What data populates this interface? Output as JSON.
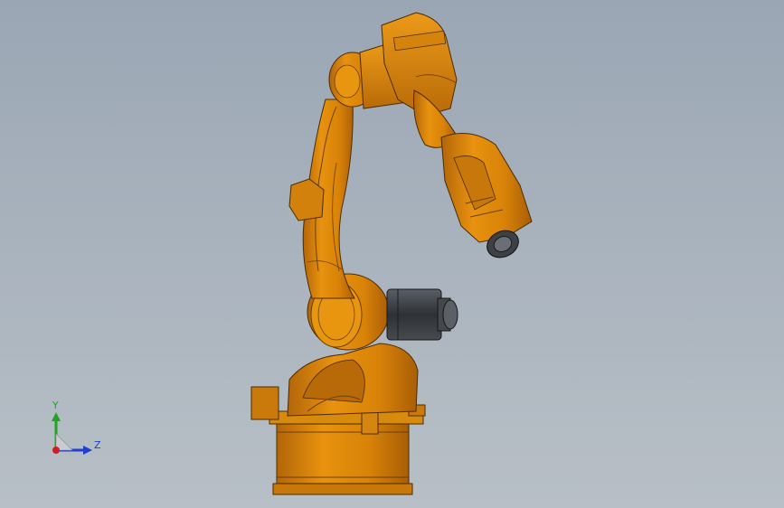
{
  "viewport": {
    "background_top": "#9aa6b4",
    "background_bottom": "#b8bfc6",
    "model": {
      "part_color": "#e08a0c",
      "shadow_color": "#b36508",
      "motor_color": "#3b3f44"
    },
    "triad": {
      "y_label": "Y",
      "z_label": "Z",
      "y_color": "#1fa51f",
      "z_color": "#1f3fcf",
      "origin_color": "#d01f1f"
    }
  }
}
